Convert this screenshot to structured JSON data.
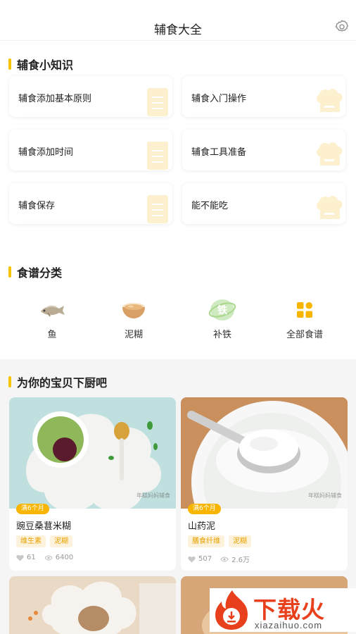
{
  "header": {
    "title": "辅食大全",
    "settings_icon": "gear-icon"
  },
  "knowledge": {
    "title": "辅食小知识",
    "cards": [
      {
        "label": "辅食添加基本原则",
        "icon": "document-icon"
      },
      {
        "label": "辅食入门操作",
        "icon": "chef-hat-icon"
      },
      {
        "label": "辅食添加时间",
        "icon": "document-icon"
      },
      {
        "label": "辅食工具准备",
        "icon": "chef-hat-icon"
      },
      {
        "label": "辅食保存",
        "icon": "document-icon"
      },
      {
        "label": "能不能吃",
        "icon": "chef-hat-icon"
      }
    ]
  },
  "categories": {
    "title": "食谱分类",
    "items": [
      {
        "label": "鱼",
        "icon": "fish-icon"
      },
      {
        "label": "泥糊",
        "icon": "porridge-bowl-icon"
      },
      {
        "label": "补铁",
        "icon": "iron-badge-icon",
        "badge_text": "铁"
      },
      {
        "label": "全部食谱",
        "icon": "grid-icon"
      }
    ]
  },
  "recipes": {
    "title": "为你的宝贝下厨吧",
    "items": [
      {
        "age": "满6个月",
        "title": "豌豆桑葚米糊",
        "tags": [
          "维生素",
          "泥糊"
        ],
        "likes": "61",
        "views": "6400",
        "watermark": "年糕妈妈辅食"
      },
      {
        "age": "满6个月",
        "title": "山药泥",
        "tags": [
          "膳食纤维",
          "泥糊"
        ],
        "likes": "507",
        "views": "2.6万",
        "watermark": "年糕妈妈辅食"
      }
    ]
  },
  "site_logo": {
    "word": "下载火",
    "url": "xiazaihuo.com"
  },
  "colors": {
    "accent": "#f6c400",
    "tag_bg": "#fdf2dc",
    "tag_text": "#e8a200",
    "logo_red": "#e8401c"
  }
}
